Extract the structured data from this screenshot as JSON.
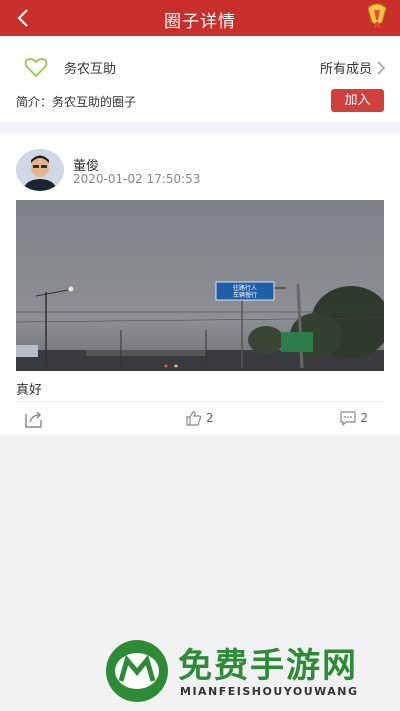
{
  "header": {
    "title": "圈子详情"
  },
  "group": {
    "name": "务农互助",
    "members_label": "所有成员",
    "intro_label": "简介：",
    "intro_text": "务农互助的圈子",
    "join_label": "加入"
  },
  "post": {
    "author": "董俊",
    "time": "2020-01-02 17:50:53",
    "text": "真好",
    "sign_text": "往路行人\n车辆慢行",
    "likes": "2",
    "comments": "2"
  },
  "watermark": {
    "title": "免费手游网",
    "subtitle": "MIANFEISHOUYOUWANG"
  },
  "colors": {
    "header": "#c9302c",
    "join": "#d0403d",
    "watermark": "#2e8b35"
  }
}
